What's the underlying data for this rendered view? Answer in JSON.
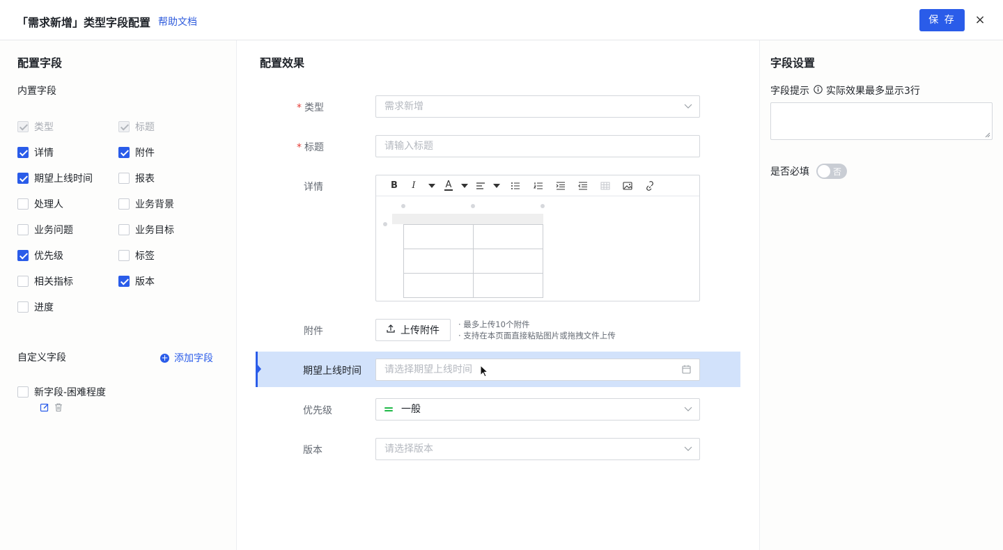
{
  "header": {
    "title": "「需求新增」类型字段配置",
    "help_link": "帮助文档",
    "save_label": "保 存",
    "close_label": "×"
  },
  "left": {
    "title": "配置字段",
    "builtin_title": "内置字段",
    "builtin_fields": [
      {
        "label": "类型",
        "checked": true,
        "disabled": true
      },
      {
        "label": "标题",
        "checked": true,
        "disabled": true
      },
      {
        "label": "详情",
        "checked": true,
        "disabled": false
      },
      {
        "label": "附件",
        "checked": true,
        "disabled": false
      },
      {
        "label": "期望上线时间",
        "checked": true,
        "disabled": false
      },
      {
        "label": "报表",
        "checked": false,
        "disabled": false
      },
      {
        "label": "处理人",
        "checked": false,
        "disabled": false
      },
      {
        "label": "业务背景",
        "checked": false,
        "disabled": false
      },
      {
        "label": "业务问题",
        "checked": false,
        "disabled": false
      },
      {
        "label": "业务目标",
        "checked": false,
        "disabled": false
      },
      {
        "label": "优先级",
        "checked": true,
        "disabled": false
      },
      {
        "label": "标签",
        "checked": false,
        "disabled": false
      },
      {
        "label": "相关指标",
        "checked": false,
        "disabled": false
      },
      {
        "label": "版本",
        "checked": true,
        "disabled": false
      },
      {
        "label": "进度",
        "checked": false,
        "disabled": false
      }
    ],
    "custom_title": "自定义字段",
    "add_field_label": "添加字段",
    "custom_fields": [
      {
        "label": "新字段-困难程度",
        "checked": false
      }
    ]
  },
  "middle": {
    "title": "配置效果",
    "fields": {
      "type": {
        "label": "类型",
        "required": "*",
        "value": "需求新增"
      },
      "title": {
        "label": "标题",
        "required": "*",
        "placeholder": "请输入标题"
      },
      "detail": {
        "label": "详情"
      },
      "attachment": {
        "label": "附件",
        "button": "上传附件",
        "tip1": "· 最多上传10个附件",
        "tip2": "· 支持在本页面直接粘贴图片或拖拽文件上传"
      },
      "launch_time": {
        "label": "期望上线时间",
        "placeholder": "请选择期望上线时间"
      },
      "priority": {
        "label": "优先级",
        "value": "一般"
      },
      "version": {
        "label": "版本",
        "placeholder": "请选择版本"
      }
    },
    "toolbar": [
      "bold",
      "italic",
      "font-color",
      "align",
      "bullet-list",
      "ordered-list",
      "indent",
      "outdent",
      "table",
      "image",
      "link"
    ],
    "toolbar_text": {
      "bold": "B",
      "italic": "I",
      "font_color": "A"
    },
    "colors": {
      "priority": "#1fb947",
      "highlight": "#d2e2fb",
      "accent": "#2a5ce9"
    }
  },
  "right": {
    "title": "字段设置",
    "hint_label": "字段提示",
    "hint_note": "实际效果最多显示3行",
    "required_label": "是否必填",
    "toggle_text": "否"
  }
}
